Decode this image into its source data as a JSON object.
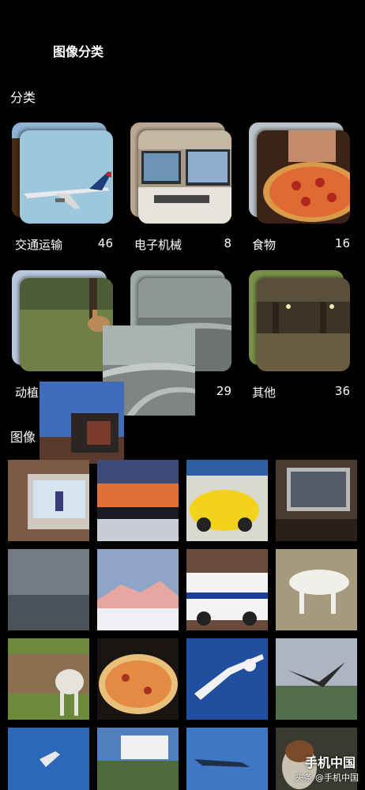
{
  "header": {
    "title": "图像分类"
  },
  "sections": {
    "categories": "分类",
    "images": "图像"
  },
  "categories": [
    {
      "label": "交通运输",
      "count": "46"
    },
    {
      "label": "电子机械",
      "count": "8"
    },
    {
      "label": "食物",
      "count": "16"
    },
    {
      "label": "动植",
      "count": ""
    },
    {
      "label": "",
      "count": "29"
    },
    {
      "label": "其他",
      "count": "36"
    }
  ],
  "watermark": {
    "logo": "手机中国",
    "text": "头条 @手机中国"
  }
}
